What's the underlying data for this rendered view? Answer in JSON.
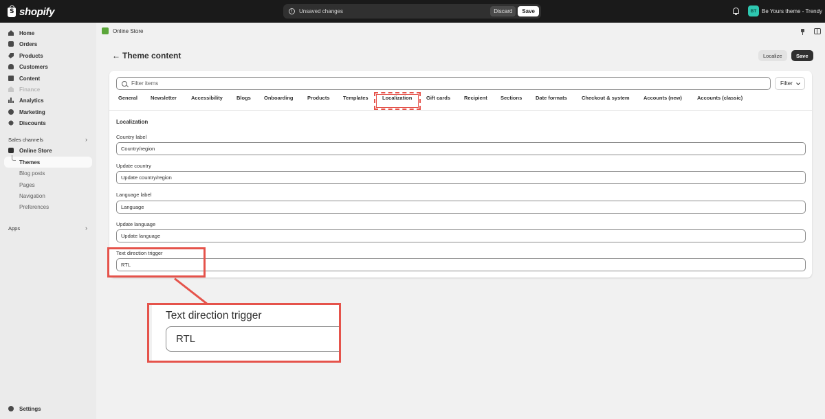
{
  "topbar": {
    "brand": "shopify",
    "unsaved_message": "Unsaved changes",
    "discard_label": "Discard",
    "save_label": "Save",
    "store_initials": "BT",
    "store_name": "Be Yours theme - Trendy"
  },
  "sidebar": {
    "items": [
      {
        "label": "Home",
        "icon": "home-icon"
      },
      {
        "label": "Orders",
        "icon": "orders-icon"
      },
      {
        "label": "Products",
        "icon": "tag-icon"
      },
      {
        "label": "Customers",
        "icon": "person-icon"
      },
      {
        "label": "Content",
        "icon": "content-icon"
      },
      {
        "label": "Finance",
        "icon": "bank-icon",
        "disabled": true
      },
      {
        "label": "Analytics",
        "icon": "chart-icon"
      },
      {
        "label": "Marketing",
        "icon": "target-icon"
      },
      {
        "label": "Discounts",
        "icon": "discount-icon"
      }
    ],
    "sales_channels_label": "Sales channels",
    "online_store_label": "Online Store",
    "sub_items": [
      "Themes",
      "Blog posts",
      "Pages",
      "Navigation",
      "Preferences"
    ],
    "apps_label": "Apps",
    "settings_label": "Settings"
  },
  "header": {
    "channel_label": "Online Store",
    "page_title": "Theme content",
    "localize_label": "Localize",
    "save_label": "Save"
  },
  "filter": {
    "placeholder": "Filter items",
    "button_label": "Filter"
  },
  "tabs": [
    "General",
    "Newsletter",
    "Accessibility",
    "Blogs",
    "Onboarding",
    "Products",
    "Templates",
    "Localization",
    "Gift cards",
    "Recipient",
    "Sections",
    "Date formats",
    "Checkout & system",
    "Accounts (new)",
    "Accounts (classic)"
  ],
  "active_tab": "Localization",
  "section_title": "Localization",
  "fields": [
    {
      "label": "Country label",
      "value": "Country/region"
    },
    {
      "label": "Update country",
      "value": "Update country/region"
    },
    {
      "label": "Language label",
      "value": "Language"
    },
    {
      "label": "Update language",
      "value": "Update language"
    },
    {
      "label": "Text direction trigger",
      "value": "RTL"
    }
  ],
  "zoom": {
    "label": "Text direction trigger",
    "value": "RTL"
  },
  "colors": {
    "topbar": "#1a1a1a",
    "highlight": "#e5534b",
    "store_avatar": "#2ec7b0"
  }
}
